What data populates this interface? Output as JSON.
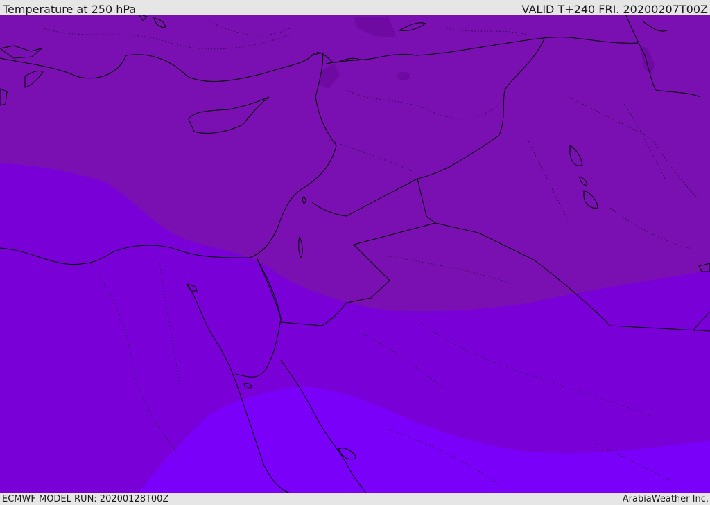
{
  "header": {
    "title": "Temperature at 250 hPa",
    "valid": "VALID T+240 FRI. 20200207T00Z"
  },
  "footer": {
    "model_run": "ECMWF MODEL RUN: 20200128T00Z",
    "credit": "ArabiaWeather Inc."
  },
  "map": {
    "colors": {
      "band_north": "#7a10b2",
      "band_middle": "#7a00d8",
      "band_south": "#7a00fa",
      "cold_pocket": "#6e0aa2",
      "coastline": "#000000",
      "border": "#000000"
    }
  }
}
